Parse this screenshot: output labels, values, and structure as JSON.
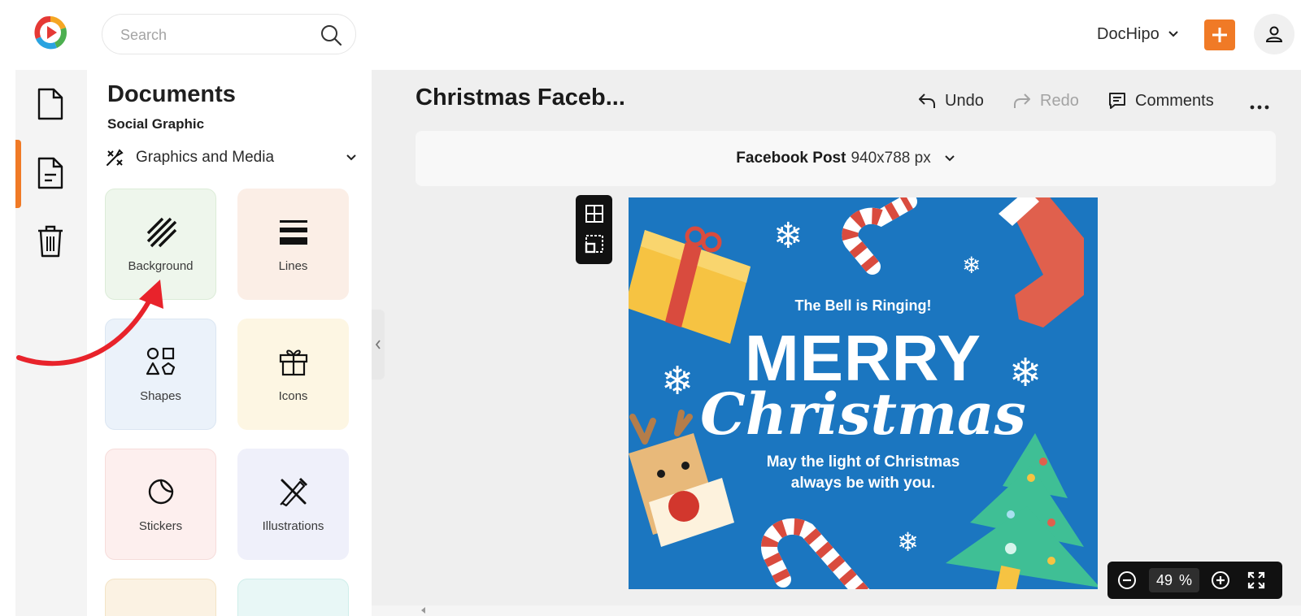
{
  "topbar": {
    "search_placeholder": "Search",
    "brand_menu_label": "DocHipo",
    "add_icon": "plus-icon",
    "user_icon": "user-icon"
  },
  "rail": {
    "items": [
      {
        "name": "document-icon"
      },
      {
        "name": "template-doc-icon",
        "active": true
      },
      {
        "name": "trash-icon"
      }
    ]
  },
  "panel": {
    "title": "Documents",
    "subtitle": "Social Graphic",
    "category": "Graphics and Media",
    "tiles": [
      {
        "label": "Background",
        "icon": "background-icon",
        "color": "#eef6ec"
      },
      {
        "label": "Lines",
        "icon": "lines-icon",
        "color": "#fbeee6"
      },
      {
        "label": "Shapes",
        "icon": "shapes-icon",
        "color": "#ebf2fa"
      },
      {
        "label": "Icons",
        "icon": "gift-icon",
        "color": "#fdf6e3"
      },
      {
        "label": "Stickers",
        "icon": "sticker-icon",
        "color": "#fdefee"
      },
      {
        "label": "Illustrations",
        "icon": "illustration-icon",
        "color": "#eff0fa"
      },
      {
        "label": "",
        "icon": "",
        "color": "#fbf2e3"
      },
      {
        "label": "",
        "icon": "",
        "color": "#e8f7f6"
      }
    ]
  },
  "editor": {
    "doc_title": "Christmas Faceb...",
    "undo_label": "Undo",
    "redo_label": "Redo",
    "comments_label": "Comments",
    "more_icon": "more-horizontal-icon",
    "size_name": "Facebook Post",
    "size_dims": "940x788 px",
    "zoom_value": "49",
    "zoom_unit": "%"
  },
  "canvas": {
    "headline_small": "The Bell is Ringing!",
    "headline_big": "MERRY",
    "headline_script": "Christmas",
    "message_line1": "May the light of Christmas",
    "message_line2": "always be with you.",
    "bg_color": "#1b76c0"
  },
  "colors": {
    "accent": "#f07a26",
    "arrow": "#e8232b"
  }
}
